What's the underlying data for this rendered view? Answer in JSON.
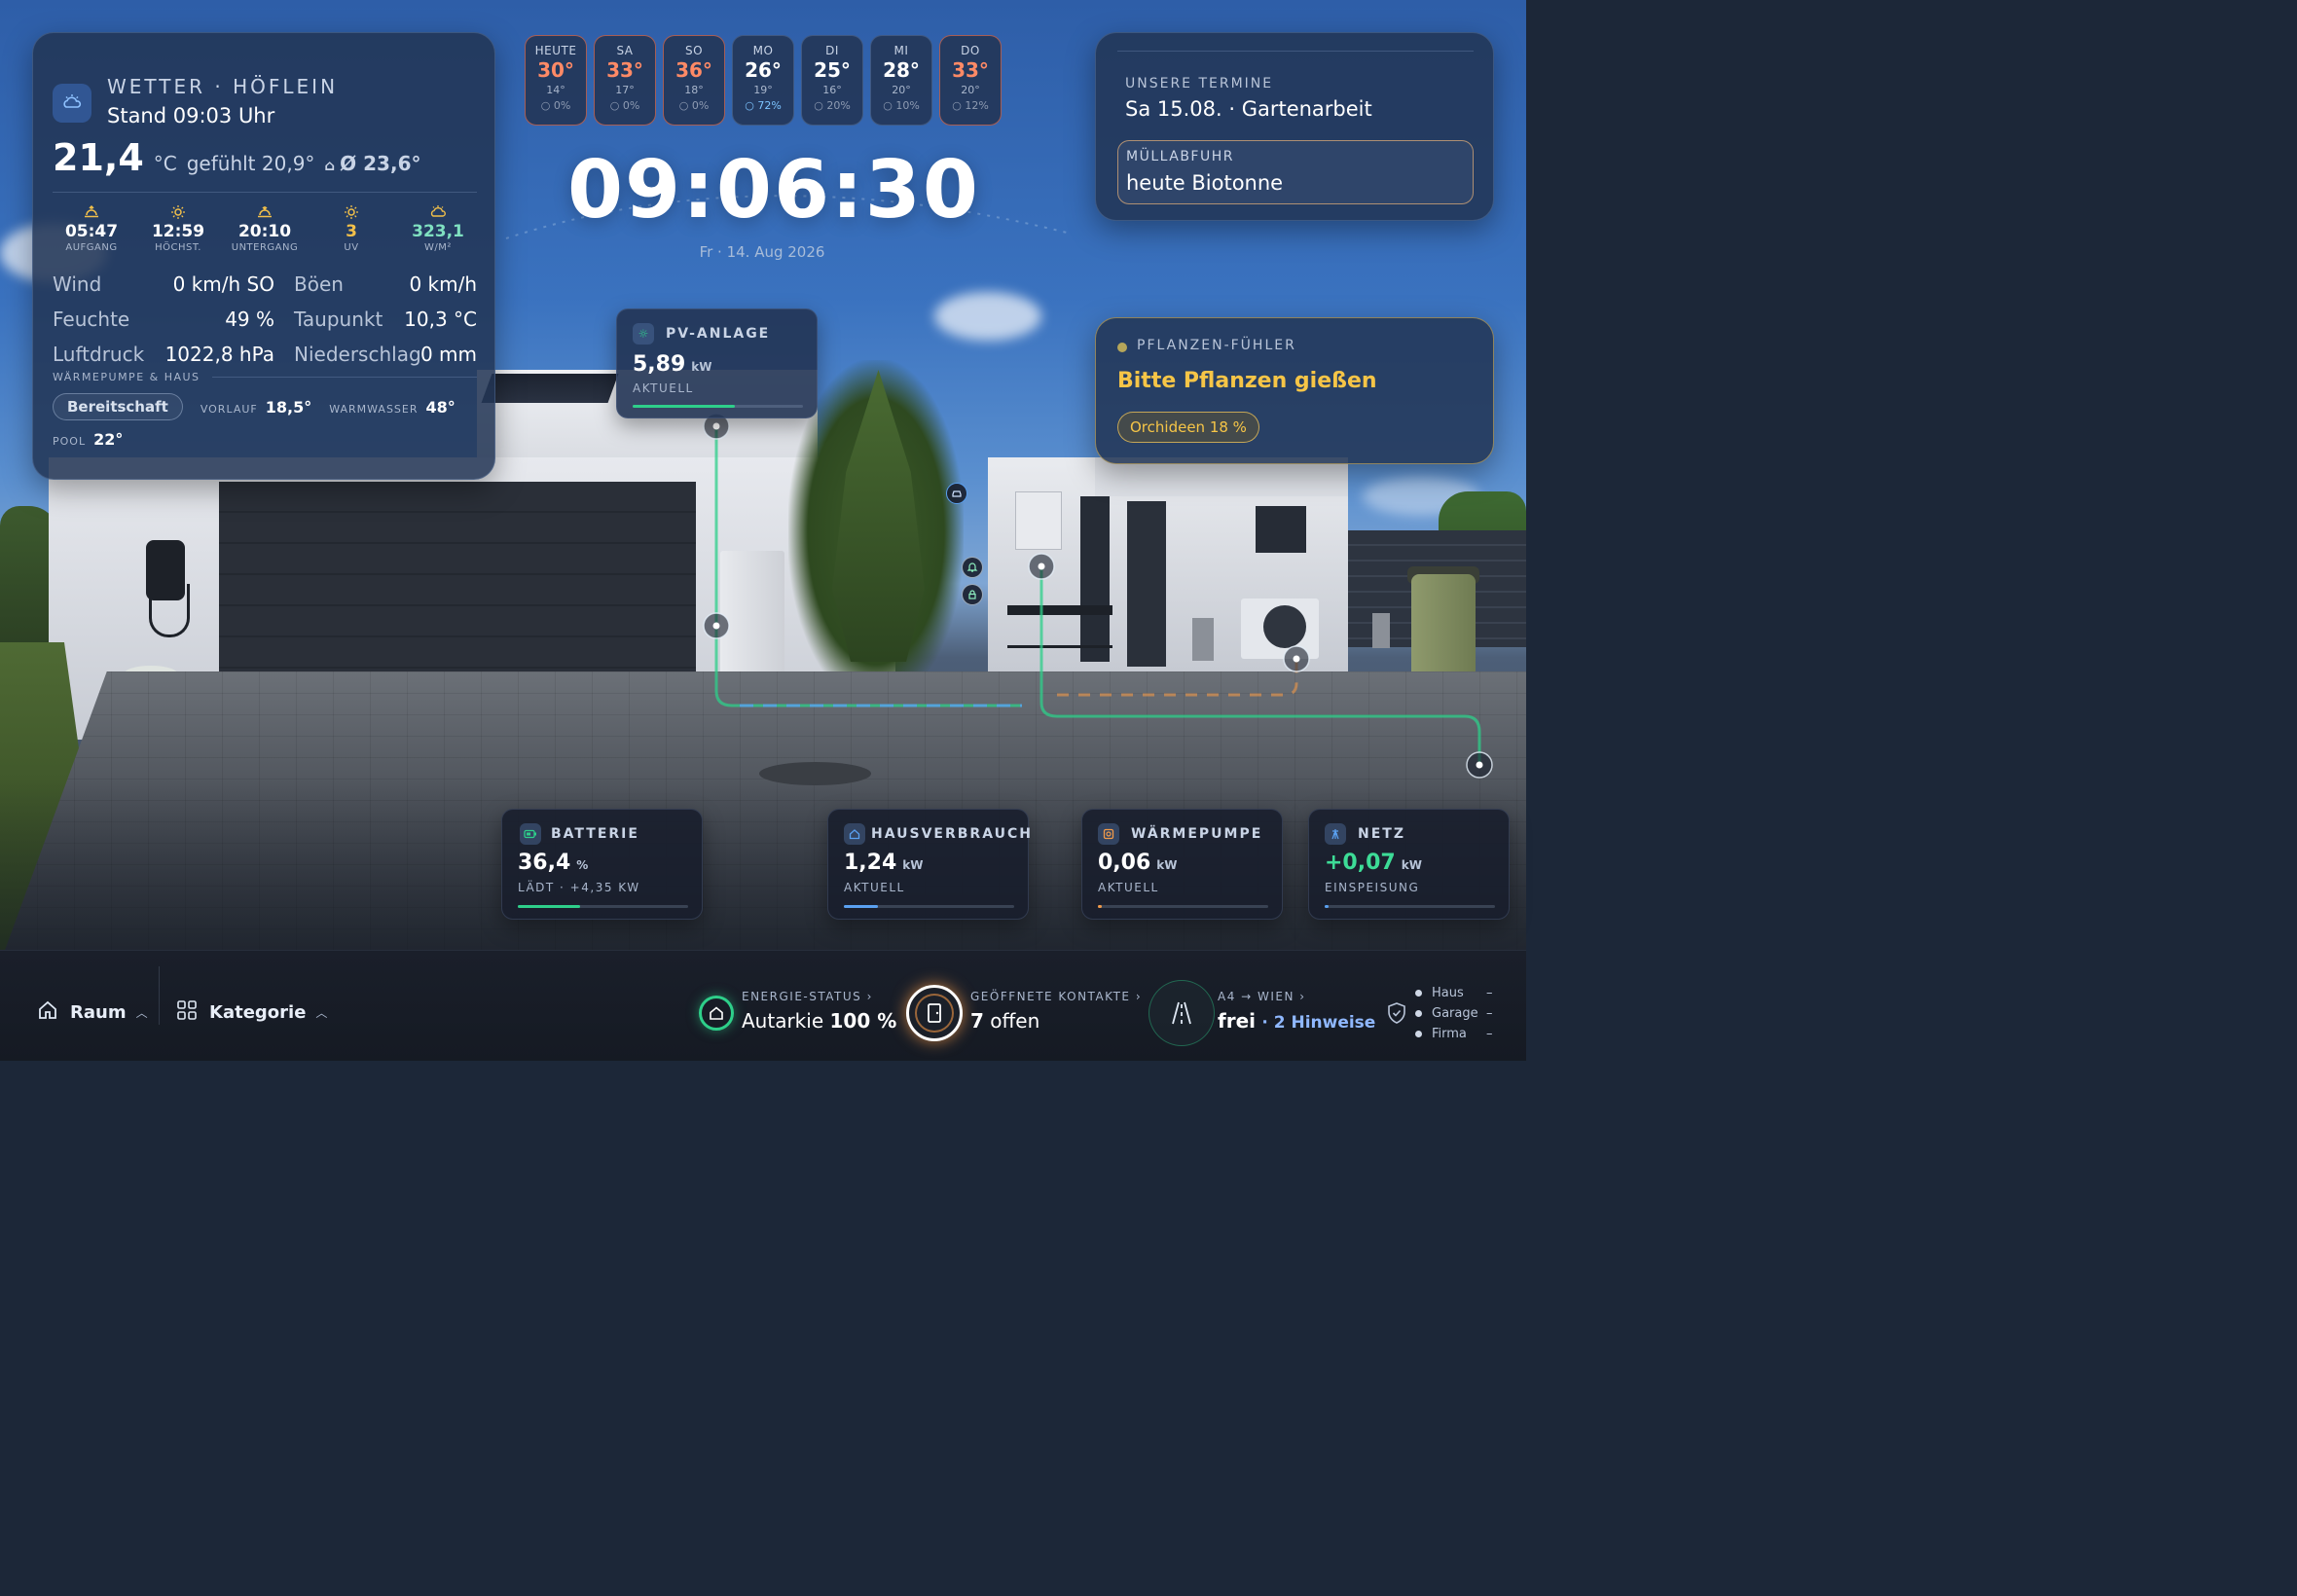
{
  "colors": {
    "accent_green": "#3ddc97",
    "pv_green": "#2ecf8a",
    "battery_green": "#2ecf8a",
    "house_blue": "#5aa0f0",
    "heatpump_orange": "#f09a4a",
    "grid_blue": "#5aa0f0",
    "hot_red": "#ff8a66",
    "plant_yellow": "#f6c547"
  },
  "weather": {
    "icon": "cloud-sun-icon",
    "title": "WETTER · HÖFLEIN",
    "stand": "Stand 09:03 Uhr",
    "temp": "21,4",
    "unit": "°C",
    "feels": "gefühlt 20,9°",
    "avg": "Ø 23,6°",
    "sun": [
      {
        "icon": "sunrise-icon",
        "value": "05:47",
        "label": "AUFGANG"
      },
      {
        "icon": "sun-icon",
        "value": "12:59",
        "label": "HÖCHST."
      },
      {
        "icon": "sunset-icon",
        "value": "20:10",
        "label": "UNTERGANG"
      },
      {
        "icon": "uv-sun-icon",
        "value": "3",
        "label": "UV"
      },
      {
        "icon": "radiation-cloud-icon",
        "value": "323,1",
        "label": "W/M²"
      }
    ],
    "metrics": [
      {
        "l1": "Wind",
        "v1": "0 km/h SO",
        "l2": "Böen",
        "v2": "0 km/h"
      },
      {
        "l1": "Feuchte",
        "v1": "49 %",
        "l2": "Taupunkt",
        "v2": "10,3 °C"
      },
      {
        "l1": "Luftdruck",
        "v1": "1022,8 hPa",
        "l2": "Niederschlag",
        "v2": "0 mm"
      }
    ],
    "wp_heading": "WÄRMEPUMPE & HAUS",
    "wp_state": "Bereitschaft",
    "vorlauf_label": "VORLAUF",
    "vorlauf_value": "18,5°",
    "warmwasser_label": "WARMWASSER",
    "warmwasser_value": "48°",
    "pool_label": "POOL",
    "pool_value": "22°"
  },
  "forecast": [
    {
      "day": "HEUTE",
      "high": "30°",
      "low": "14°",
      "rain": "0%",
      "hot": true
    },
    {
      "day": "SA",
      "high": "33°",
      "low": "17°",
      "rain": "0%",
      "hot": true
    },
    {
      "day": "SO",
      "high": "36°",
      "low": "18°",
      "rain": "0%",
      "hot": true
    },
    {
      "day": "MO",
      "high": "26°",
      "low": "19°",
      "rain": "72%",
      "hot": false
    },
    {
      "day": "DI",
      "high": "25°",
      "low": "16°",
      "rain": "20%",
      "hot": false
    },
    {
      "day": "MI",
      "high": "28°",
      "low": "20°",
      "rain": "10%",
      "hot": false
    },
    {
      "day": "DO",
      "high": "33°",
      "low": "20°",
      "rain": "12%",
      "hot": true
    }
  ],
  "clock": {
    "time": "09:06:30",
    "date": "Fr · 14. Aug 2026"
  },
  "termine": {
    "label": "UNSERE TERMINE",
    "value": "Sa 15.08. · Gartenarbeit",
    "muell_label": "MÜLLABFUHR",
    "muell_value": "heute Biotonne"
  },
  "plants": {
    "label": "PFLANZEN-FÜHLER",
    "message": "Bitte Pflanzen gießen",
    "tag": "Orchideen 18 %"
  },
  "energy": {
    "pv": {
      "title": "PV-ANLAGE",
      "value": "5,89",
      "unit": "kW",
      "sub": "AKTUELL",
      "level": 0.6
    },
    "battery": {
      "title": "BATTERIE",
      "value": "36,4",
      "unit": "%",
      "sub": "LÄDT · +4,35 KW",
      "level": 0.364
    },
    "house": {
      "title": "HAUSVERBRAUCH",
      "value": "1,24",
      "unit": "kW",
      "sub": "AKTUELL",
      "level": 0.2
    },
    "heatpump": {
      "title": "WÄRMEPUMPE",
      "value": "0,06",
      "unit": "kW",
      "sub": "AKTUELL",
      "level": 0.02
    },
    "grid": {
      "title": "NETZ",
      "value": "+0,07",
      "unit": "kW",
      "sub": "EINSPEISUNG",
      "level": 0.02
    }
  },
  "bottombar": {
    "raum": "Raum",
    "kategorie": "Kategorie",
    "energie_label": "ENERGIE-STATUS ›",
    "energie_prefix": "Autarkie",
    "energie_value": "100 %",
    "kontakte_label": "GEÖFFNETE KONTAKTE ›",
    "kontakte_value": "7",
    "kontakte_suffix": "offen",
    "traffic_label": "A4 → WIEN ›",
    "traffic_value": "frei",
    "traffic_suffix": "· 2 Hinweise",
    "legend": [
      {
        "name": "Haus",
        "value": "–"
      },
      {
        "name": "Garage",
        "value": "–"
      },
      {
        "name": "Firma",
        "value": "–"
      }
    ]
  }
}
